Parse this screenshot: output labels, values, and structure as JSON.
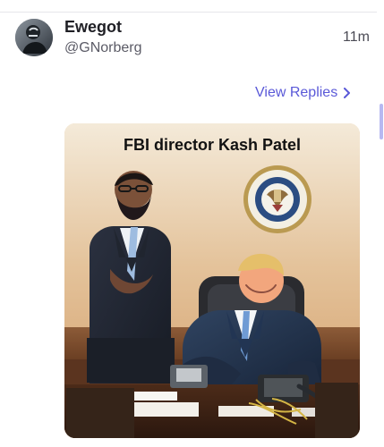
{
  "post": {
    "author_name": "Ewegot",
    "author_handle": "@GNorberg",
    "timestamp": "11m",
    "view_replies_label": "View Replies",
    "image_caption": "FBI director Kash Patel"
  },
  "colors": {
    "accent": "#5a59d8",
    "scrollbar": "#b7b8f1"
  },
  "icons": {
    "view_replies": "chevron-right-icon",
    "avatar": "profile-avatar"
  }
}
